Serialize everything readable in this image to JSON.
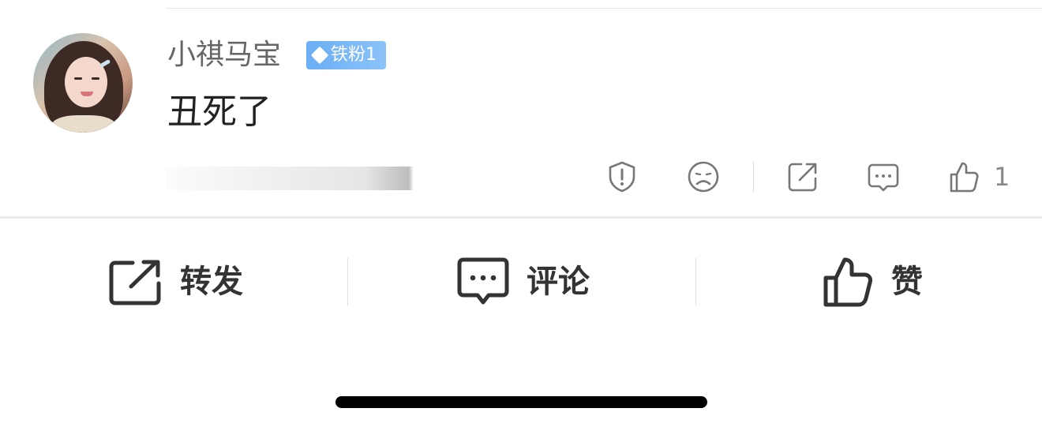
{
  "comment": {
    "username": "小祺马宝",
    "badge": "铁粉1",
    "text": "丑死了",
    "like_count": "1"
  },
  "actions": {
    "report_icon": "shield-exclamation-icon",
    "dislike_icon": "sad-face-icon",
    "share_icon": "share-icon",
    "reply_icon": "comment-icon",
    "like_icon": "thumbs-up-icon"
  },
  "bottom_bar": {
    "repost_label": "转发",
    "comment_label": "评论",
    "like_label": "赞"
  },
  "colors": {
    "badge": "#6aaef5",
    "text_primary": "#222222",
    "text_secondary": "#666666",
    "icon": "#333333"
  }
}
